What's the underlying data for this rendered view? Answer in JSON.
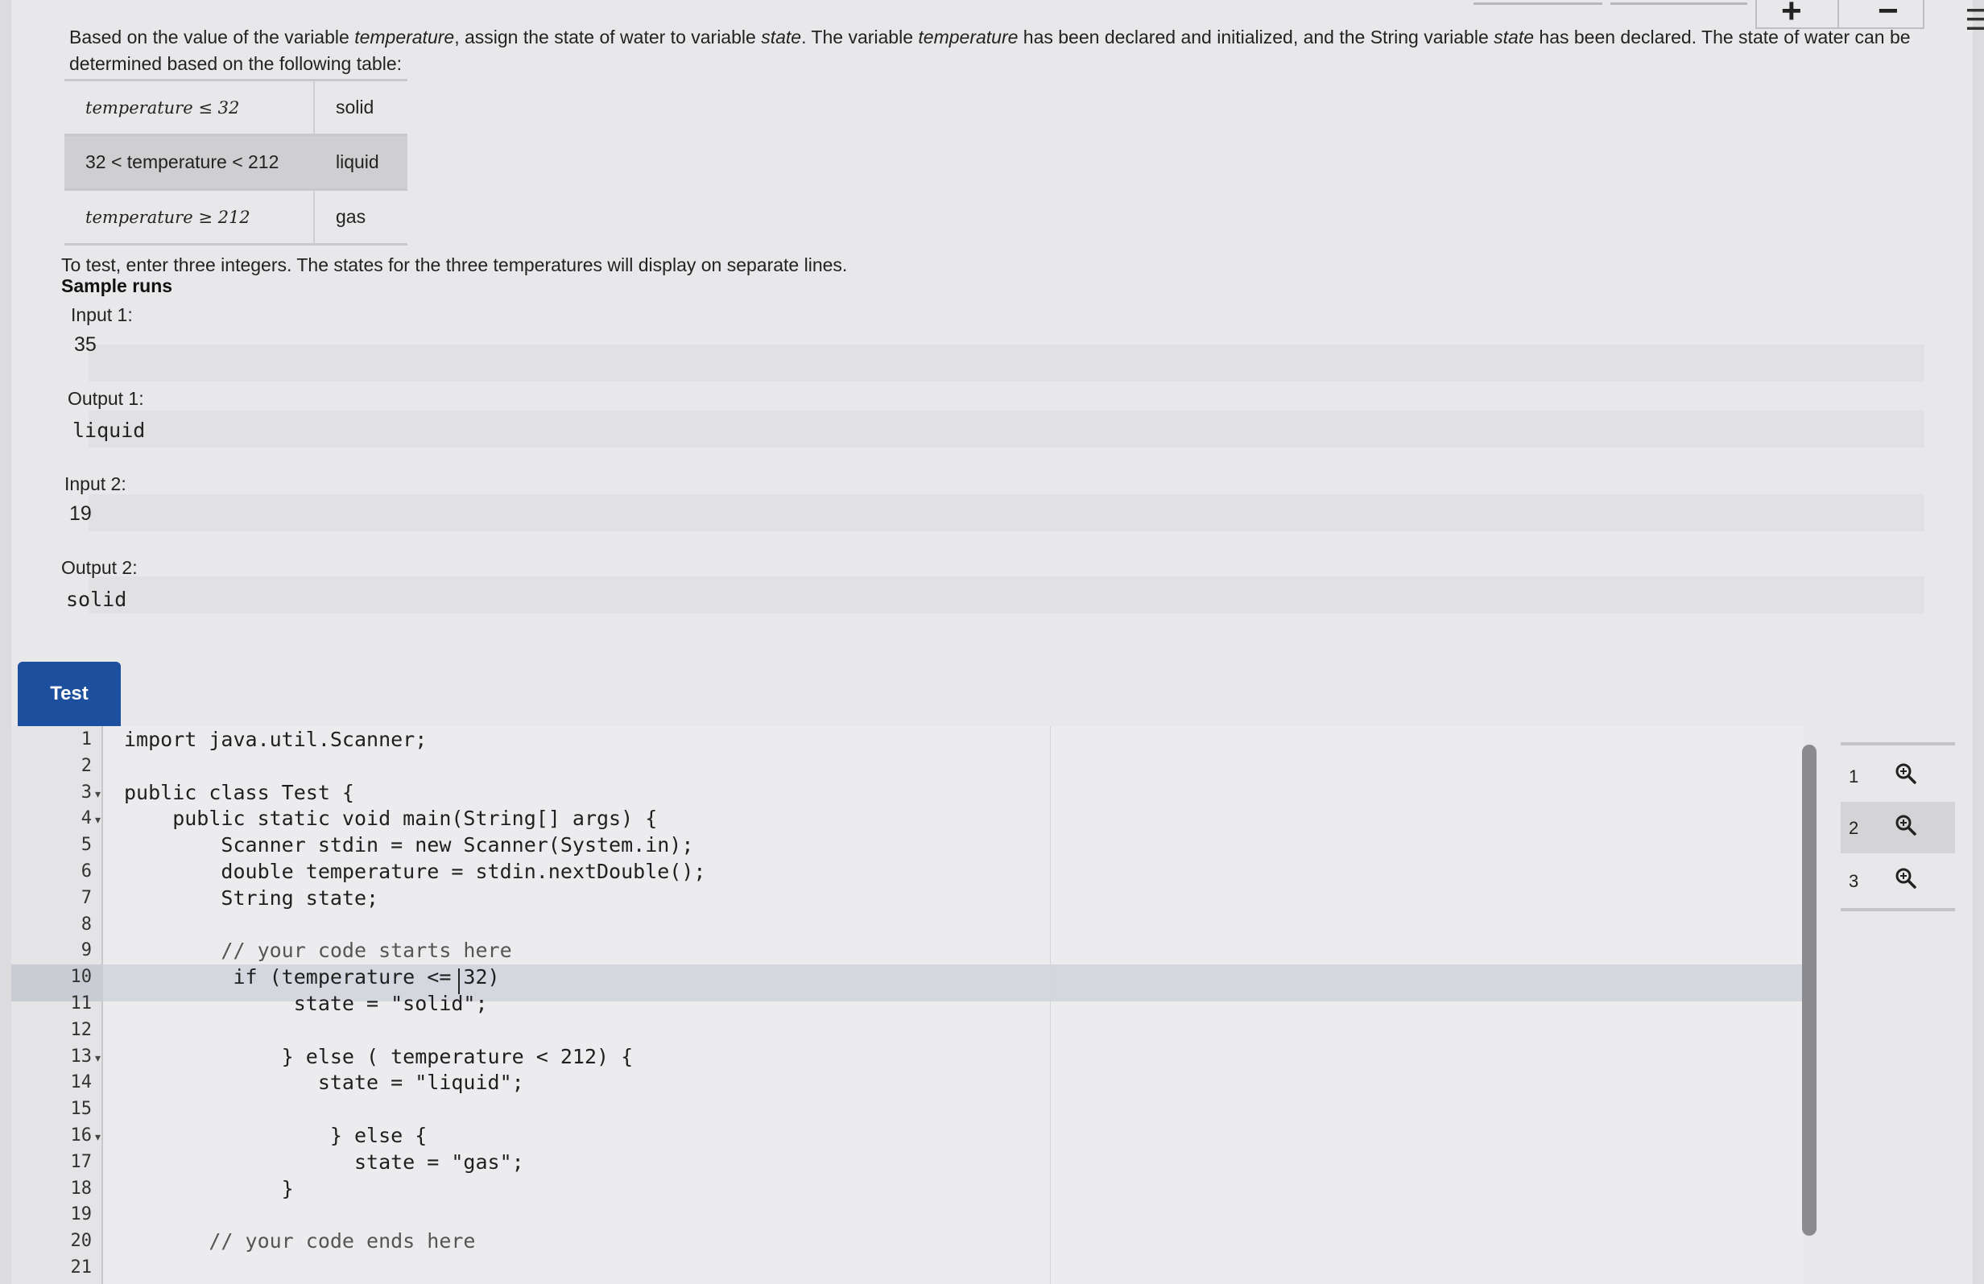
{
  "prompt": {
    "p1": "Based on the value of the variable ",
    "var_temperature": "temperature",
    "p2": ", assign the state of water to variable ",
    "var_state": "state",
    "p3": ". The variable ",
    "var_temperature2": "temperature",
    "p4": " has been declared and initialized, and the String variable ",
    "var_state2": "state",
    "p5": " has been declared. The state of water can be determined based on the following table:"
  },
  "table": {
    "rows": [
      {
        "condition": "temperature ≤ 32",
        "state": "solid"
      },
      {
        "condition": "32 < temperature < 212",
        "state": "liquid"
      },
      {
        "condition": "temperature ≥ 212",
        "state": "gas"
      }
    ]
  },
  "instructions": "To test, enter three integers. The states for the three temperatures will display on separate lines.",
  "sample_runs": {
    "title": "Sample runs",
    "input1_label": "Input 1:",
    "input1_value": "35",
    "output1_label": "Output 1:",
    "output1_value": "liquid",
    "input2_label": "Input 2:",
    "input2_value": "19",
    "output2_label": "Output 2:",
    "output2_value": "solid"
  },
  "test_button": "Test",
  "editor": {
    "line_numbers": [
      "1",
      "2",
      "3",
      "4",
      "5",
      "6",
      "7",
      "8",
      "9",
      "10",
      "11",
      "12",
      "13",
      "14",
      "15",
      "16",
      "17",
      "18",
      "19",
      "20",
      "21"
    ],
    "code": [
      "import java.util.Scanner;",
      "",
      "public class Test {",
      "    public static void main(String[] args) {",
      "        Scanner stdin = new Scanner(System.in);",
      "        double temperature = stdin.nextDouble();",
      "        String state;",
      "",
      "        // your code starts here",
      "         if (temperature <= 32)",
      "              state = \"solid\";",
      "",
      "             } else ( temperature < 212) {",
      "                state = \"liquid\";",
      "",
      "                 } else {",
      "                   state = \"gas\";",
      "             }",
      "",
      "       // your code ends here",
      ""
    ]
  },
  "test_cases": [
    {
      "label": "1"
    },
    {
      "label": "2"
    },
    {
      "label": "3"
    }
  ],
  "zoom": {
    "plus": "+",
    "minus": "−"
  },
  "icons": {
    "zoom_in": "magnify-plus-icon",
    "fold": "caret-down-icon",
    "menu": "menu-icon"
  },
  "colors": {
    "accent": "#1d4f9f",
    "background": "#e8e8ea"
  }
}
